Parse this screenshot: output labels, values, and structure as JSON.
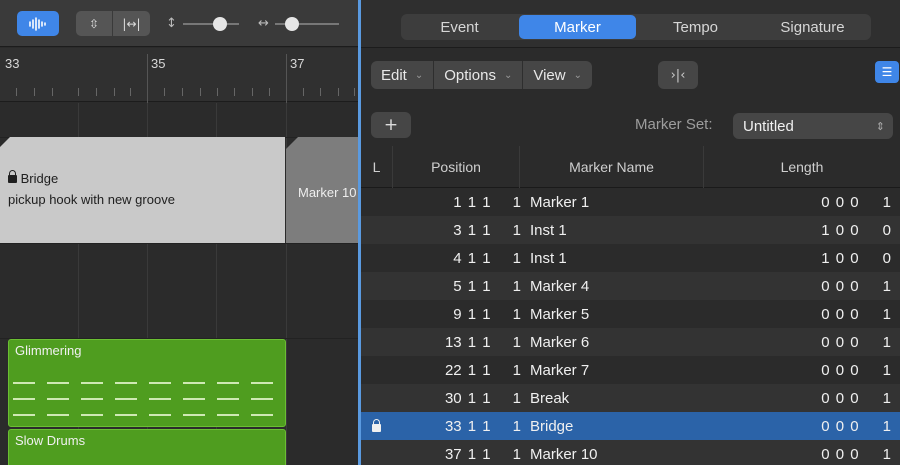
{
  "left": {
    "ruler_bars": [
      "33",
      "35",
      "37"
    ],
    "regions": {
      "bridge": {
        "title": "Bridge",
        "subtitle": "pickup hook with new groove"
      },
      "marker10": {
        "title": "Marker 10"
      },
      "glimmering": {
        "title": "Glimmering"
      },
      "slow_drums": {
        "title": "Slow Drums"
      }
    }
  },
  "right": {
    "tabs": [
      "Event",
      "Marker",
      "Tempo",
      "Signature"
    ],
    "active_tab": "Marker",
    "menus": [
      "Edit",
      "Options",
      "View"
    ],
    "marker_set_label": "Marker Set:",
    "marker_set_value": "Untitled",
    "columns": {
      "lock": "L",
      "position": "Position",
      "name": "Marker Name",
      "length": "Length"
    },
    "rows": [
      {
        "position": "1 1 1",
        "pos_tick": "1",
        "name": "Marker 1",
        "length": "0 0 0",
        "len_tick": "1",
        "locked": false,
        "selected": false
      },
      {
        "position": "3 1 1",
        "pos_tick": "1",
        "name": "Inst 1",
        "length": "1 0 0",
        "len_tick": "0",
        "locked": false,
        "selected": false
      },
      {
        "position": "4 1 1",
        "pos_tick": "1",
        "name": "Inst 1",
        "length": "1 0 0",
        "len_tick": "0",
        "locked": false,
        "selected": false
      },
      {
        "position": "5 1 1",
        "pos_tick": "1",
        "name": "Marker 4",
        "length": "0 0 0",
        "len_tick": "1",
        "locked": false,
        "selected": false
      },
      {
        "position": "9 1 1",
        "pos_tick": "1",
        "name": "Marker 5",
        "length": "0 0 0",
        "len_tick": "1",
        "locked": false,
        "selected": false
      },
      {
        "position": "13 1 1",
        "pos_tick": "1",
        "name": "Marker 6",
        "length": "0 0 0",
        "len_tick": "1",
        "locked": false,
        "selected": false
      },
      {
        "position": "22 1 1",
        "pos_tick": "1",
        "name": "Marker 7",
        "length": "0 0 0",
        "len_tick": "1",
        "locked": false,
        "selected": false
      },
      {
        "position": "30 1 1",
        "pos_tick": "1",
        "name": "Break",
        "length": "0 0 0",
        "len_tick": "1",
        "locked": false,
        "selected": false
      },
      {
        "position": "33 1 1",
        "pos_tick": "1",
        "name": "Bridge",
        "length": "0 0 0",
        "len_tick": "1",
        "locked": true,
        "selected": true
      },
      {
        "position": "37 1 1",
        "pos_tick": "1",
        "name": "Marker 10",
        "length": "0 0 0",
        "len_tick": "1",
        "locked": false,
        "selected": false
      }
    ]
  },
  "colors": {
    "accent": "#3f86e8",
    "selection": "#2b63a8",
    "region_green": "#4f9d1f",
    "region_gray": "#c9c9c9"
  }
}
